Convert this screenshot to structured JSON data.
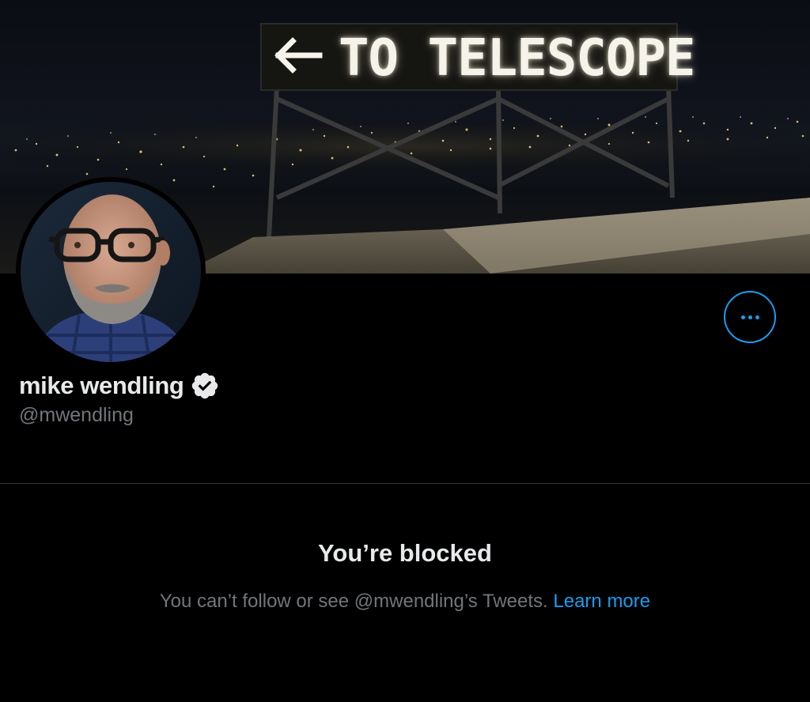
{
  "banner": {
    "sign_arrow": "←",
    "sign_text": "TO TELESCOPE"
  },
  "profile": {
    "display_name": "mike wendling",
    "handle": "@mwendling",
    "verified": true
  },
  "blocked": {
    "title": "You’re blocked",
    "description": "You can’t follow or see @mwendling’s Tweets.",
    "learn_more": "Learn more"
  },
  "icons": {
    "more": "more-horizontal-icon",
    "verified": "verified-badge-icon"
  },
  "colors": {
    "background": "#000000",
    "text_primary": "#e7e9ea",
    "text_secondary": "#71767b",
    "accent": "#1d9bf0",
    "divider": "#2f3336"
  }
}
